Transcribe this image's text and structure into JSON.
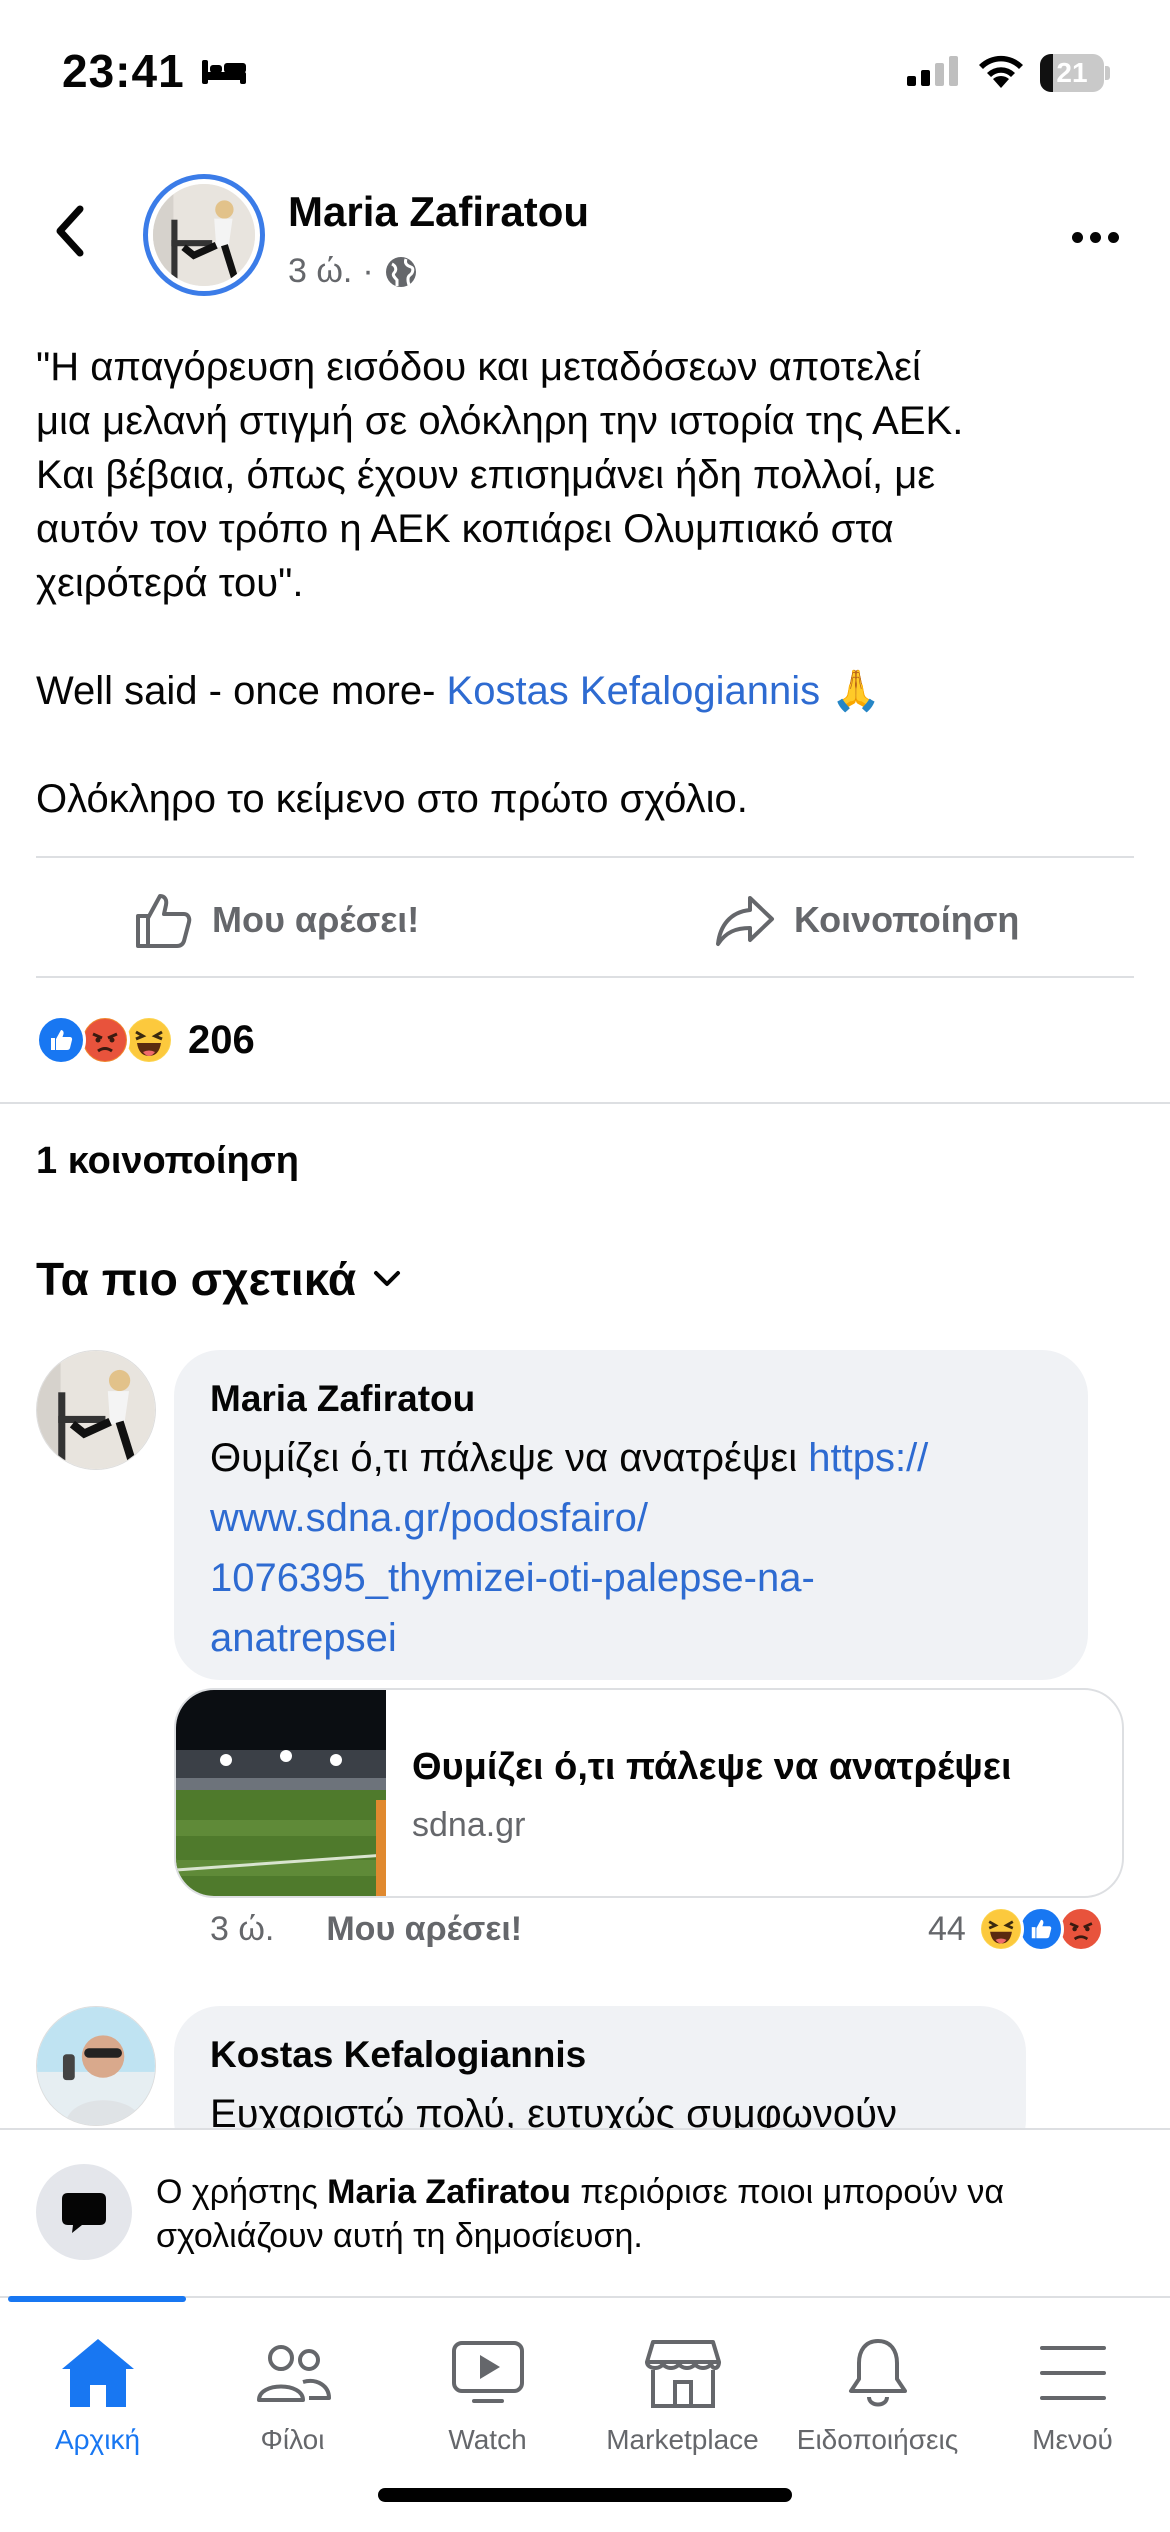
{
  "status_bar": {
    "time": "23:41",
    "battery_level": 21,
    "battery_label": "21"
  },
  "post": {
    "author": "Maria Zafiratou",
    "time_ago": "3 ώ.",
    "separator": "·",
    "text_lines": [
      "\"Η απαγόρευση εισόδου και μεταδόσεων αποτελεί",
      "μια μελανή στιγμή σε ολόκληρη την ιστορία της ΑΕΚ.",
      "Και βέβαια, όπως έχουν επισημάνει ήδη πολλοί, με",
      "αυτόν τον τρόπο η ΑΕΚ κοπιάρει Ολυμπιακό στα",
      "χειρότερά του\"."
    ],
    "well_said_prefix": "Well said - once more- ",
    "mention": "Kostas Kefalogiannis",
    "emoji": "🙏",
    "footer_line": "Ολόκληρο το κείμενο στο πρώτο σχόλιο.",
    "like_label": "Μου αρέσει!",
    "share_label": "Κοινοποίηση",
    "reactions": [
      "like",
      "angry",
      "haha"
    ],
    "reaction_count": "206",
    "shares_label": "1 κοινοποίηση"
  },
  "comments_section": {
    "sort_label": "Τα πιο σχετικά"
  },
  "comments": [
    {
      "author": "Maria Zafiratou",
      "text_prefix": "Θυμίζει ό,τι πάλεψε να ανατρέψει ",
      "link_lines": [
        "https://",
        "www.sdna.gr/podosfairo/",
        "1076395_thymizei-oti-palepse-na-",
        "anatrepsei"
      ],
      "card_title": "Θυμίζει ό,τι πάλεψε να ανατρέψει",
      "card_domain": "sdna.gr",
      "time_ago": "3 ώ.",
      "like_label": "Μου αρέσει!",
      "reaction_count": "44",
      "reactions": [
        "haha",
        "like",
        "angry"
      ]
    },
    {
      "author": "Kostas Kefalogiannis",
      "text": "Ευχαριστώ πολύ, ευτυχώς συμφωνούν"
    }
  ],
  "restriction": {
    "prefix": "Ο χρήστης ",
    "name": "Maria Zafiratou",
    "suffix": " περιόρισε ποιοι μπορούν να σχολιάζουν αυτή τη δημοσίευση."
  },
  "tabs": [
    {
      "label": "Αρχική",
      "icon": "home-icon",
      "active": true
    },
    {
      "label": "Φίλοι",
      "icon": "friends-icon",
      "active": false
    },
    {
      "label": "Watch",
      "icon": "watch-icon",
      "active": false
    },
    {
      "label": "Marketplace",
      "icon": "marketplace-icon",
      "active": false
    },
    {
      "label": "Ειδοποιήσεις",
      "icon": "bell-icon",
      "active": false
    },
    {
      "label": "Μενού",
      "icon": "menu-icon",
      "active": false
    }
  ],
  "colors": {
    "accent": "#1877f2",
    "link": "#2e6bd1",
    "secondary_text": "#65676b",
    "bubble": "#f0f2f5"
  }
}
